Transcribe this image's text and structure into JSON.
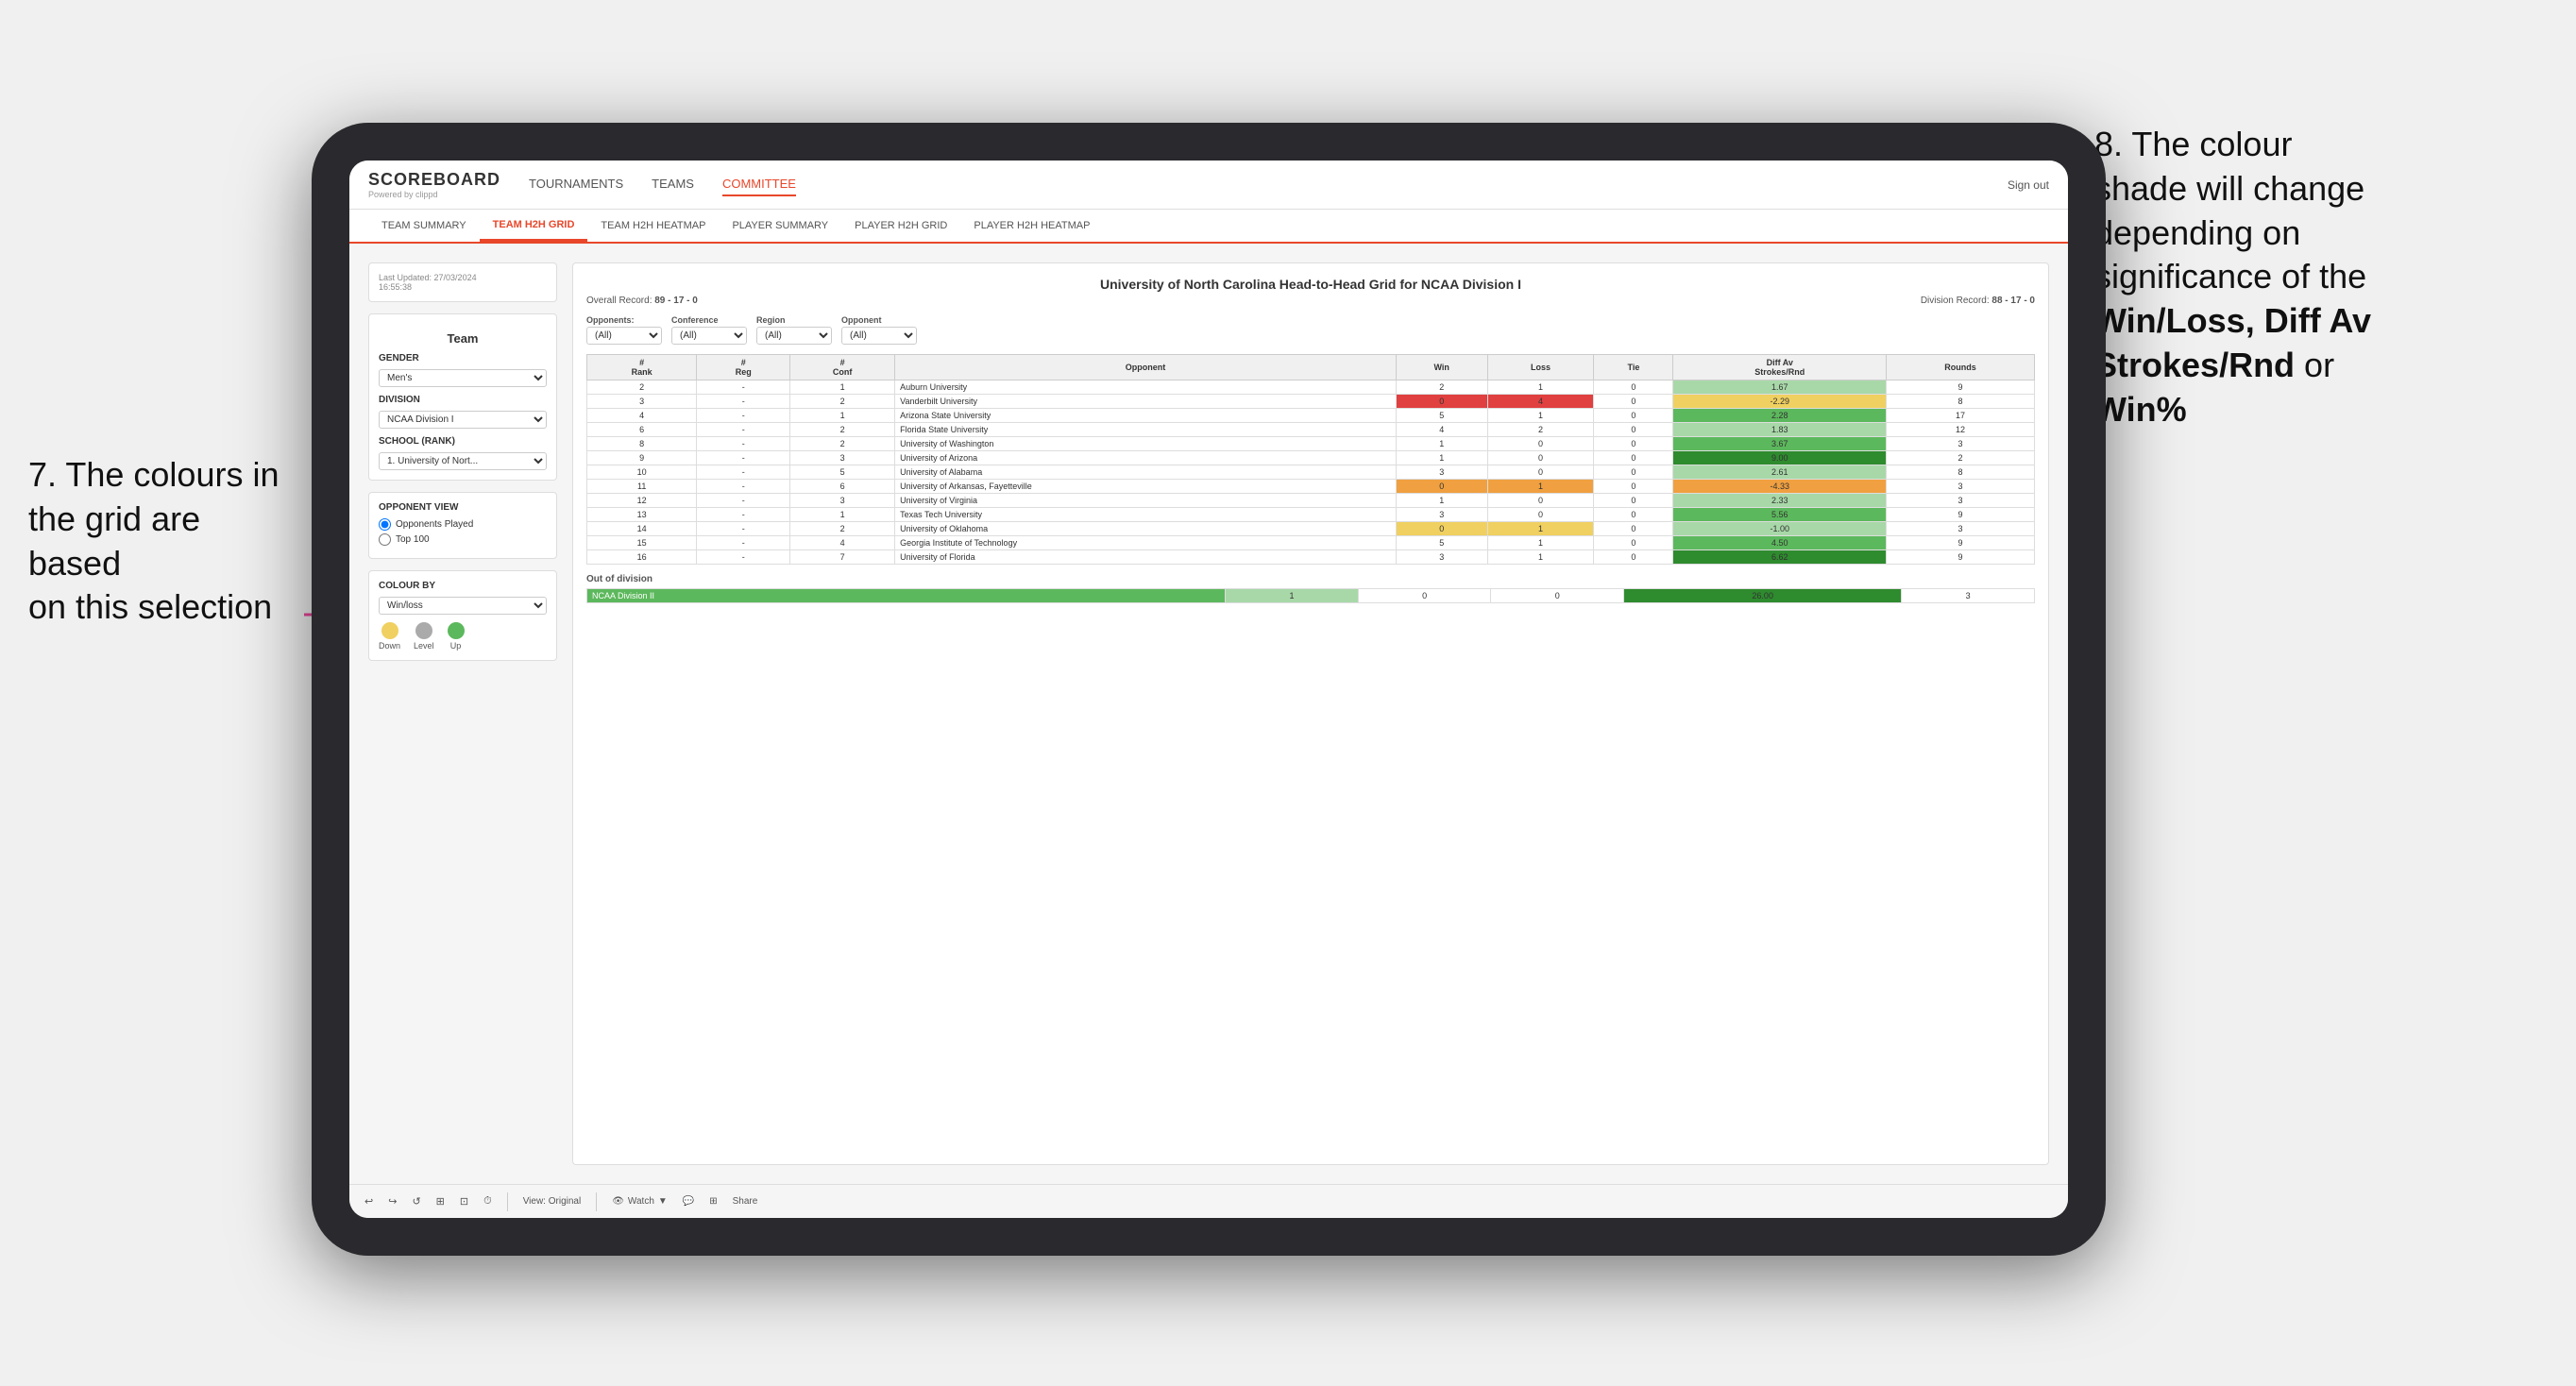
{
  "annotation_left": {
    "line1": "7. The colours in",
    "line2": "the grid are based",
    "line3": "on this selection"
  },
  "annotation_right": {
    "line1": "8. The colour",
    "line2": "shade will change",
    "line3": "depending on",
    "line4": "significance of the",
    "bold1": "Win/Loss",
    "comma1": ", ",
    "bold2": "Diff Av",
    "line5": "Strokes/Rnd",
    "line6": " or",
    "bold3": "Win%"
  },
  "nav": {
    "logo": "SCOREBOARD",
    "logo_sub": "Powered by clippd",
    "links": [
      "TOURNAMENTS",
      "TEAMS",
      "COMMITTEE"
    ],
    "sign_out": "Sign out"
  },
  "sub_nav": {
    "items": [
      "TEAM SUMMARY",
      "TEAM H2H GRID",
      "TEAM H2H HEATMAP",
      "PLAYER SUMMARY",
      "PLAYER H2H GRID",
      "PLAYER H2H HEATMAP"
    ],
    "active": "TEAM H2H GRID"
  },
  "sidebar": {
    "updated": "Last Updated: 27/03/2024",
    "updated_time": "16:55:38",
    "team_section_label": "Team",
    "gender_label": "Gender",
    "gender_value": "Men's",
    "division_label": "Division",
    "division_value": "NCAA Division I",
    "school_label": "School (Rank)",
    "school_value": "1. University of Nort...",
    "opponent_view_label": "Opponent View",
    "opponent_options": [
      "Opponents Played",
      "Top 100"
    ],
    "colour_by_label": "Colour by",
    "colour_by_value": "Win/loss",
    "legend": {
      "down": "Down",
      "level": "Level",
      "up": "Up"
    }
  },
  "grid": {
    "title": "University of North Carolina Head-to-Head Grid for NCAA Division I",
    "overall_record_label": "Overall Record:",
    "overall_record": "89 - 17 - 0",
    "division_record_label": "Division Record:",
    "division_record": "88 - 17 - 0",
    "filters": {
      "opponents_label": "Opponents:",
      "opponents_value": "(All)",
      "conference_label": "Conference",
      "conference_value": "(All)",
      "region_label": "Region",
      "region_value": "(All)",
      "opponent_label": "Opponent",
      "opponent_value": "(All)"
    },
    "columns": [
      "#\nRank",
      "#\nReg",
      "#\nConf",
      "Opponent",
      "Win",
      "Loss",
      "Tie",
      "Diff Av\nStrokes/Rnd",
      "Rounds"
    ],
    "rows": [
      {
        "rank": "2",
        "reg": "-",
        "conf": "1",
        "opponent": "Auburn University",
        "win": "2",
        "loss": "1",
        "tie": "0",
        "diff": "1.67",
        "rounds": "9",
        "win_color": "white",
        "diff_color": "green_light"
      },
      {
        "rank": "3",
        "reg": "-",
        "conf": "2",
        "opponent": "Vanderbilt University",
        "win": "0",
        "loss": "4",
        "tie": "0",
        "diff": "-2.29",
        "rounds": "8",
        "win_color": "red",
        "diff_color": "yellow"
      },
      {
        "rank": "4",
        "reg": "-",
        "conf": "1",
        "opponent": "Arizona State University",
        "win": "5",
        "loss": "1",
        "tie": "0",
        "diff": "2.28",
        "rounds": "17",
        "win_color": "white",
        "diff_color": "green_med"
      },
      {
        "rank": "6",
        "reg": "-",
        "conf": "2",
        "opponent": "Florida State University",
        "win": "4",
        "loss": "2",
        "tie": "0",
        "diff": "1.83",
        "rounds": "12",
        "win_color": "white",
        "diff_color": "green_light"
      },
      {
        "rank": "8",
        "reg": "-",
        "conf": "2",
        "opponent": "University of Washington",
        "win": "1",
        "loss": "0",
        "tie": "0",
        "diff": "3.67",
        "rounds": "3",
        "win_color": "white",
        "diff_color": "green_med"
      },
      {
        "rank": "9",
        "reg": "-",
        "conf": "3",
        "opponent": "University of Arizona",
        "win": "1",
        "loss": "0",
        "tie": "0",
        "diff": "9.00",
        "rounds": "2",
        "win_color": "white",
        "diff_color": "green_dark"
      },
      {
        "rank": "10",
        "reg": "-",
        "conf": "5",
        "opponent": "University of Alabama",
        "win": "3",
        "loss": "0",
        "tie": "0",
        "diff": "2.61",
        "rounds": "8",
        "win_color": "white",
        "diff_color": "green_light"
      },
      {
        "rank": "11",
        "reg": "-",
        "conf": "6",
        "opponent": "University of Arkansas, Fayetteville",
        "win": "0",
        "loss": "1",
        "tie": "0",
        "diff": "-4.33",
        "rounds": "3",
        "win_color": "orange",
        "diff_color": "orange"
      },
      {
        "rank": "12",
        "reg": "-",
        "conf": "3",
        "opponent": "University of Virginia",
        "win": "1",
        "loss": "0",
        "tie": "0",
        "diff": "2.33",
        "rounds": "3",
        "win_color": "white",
        "diff_color": "green_light"
      },
      {
        "rank": "13",
        "reg": "-",
        "conf": "1",
        "opponent": "Texas Tech University",
        "win": "3",
        "loss": "0",
        "tie": "0",
        "diff": "5.56",
        "rounds": "9",
        "win_color": "white",
        "diff_color": "green_med"
      },
      {
        "rank": "14",
        "reg": "-",
        "conf": "2",
        "opponent": "University of Oklahoma",
        "win": "0",
        "loss": "1",
        "tie": "0",
        "diff": "-1.00",
        "rounds": "3",
        "win_color": "yellow",
        "diff_color": "green_light"
      },
      {
        "rank": "15",
        "reg": "-",
        "conf": "4",
        "opponent": "Georgia Institute of Technology",
        "win": "5",
        "loss": "1",
        "tie": "0",
        "diff": "4.50",
        "rounds": "9",
        "win_color": "white",
        "diff_color": "green_med"
      },
      {
        "rank": "16",
        "reg": "-",
        "conf": "7",
        "opponent": "University of Florida",
        "win": "3",
        "loss": "1",
        "tie": "0",
        "diff": "6.62",
        "rounds": "9",
        "win_color": "white",
        "diff_color": "green_dark"
      }
    ],
    "out_of_division_label": "Out of division",
    "out_of_division_rows": [
      {
        "division": "NCAA Division II",
        "win": "1",
        "loss": "0",
        "tie": "0",
        "diff": "26.00",
        "rounds": "3"
      }
    ]
  },
  "toolbar": {
    "view_original": "View: Original",
    "watch": "Watch",
    "share": "Share"
  }
}
